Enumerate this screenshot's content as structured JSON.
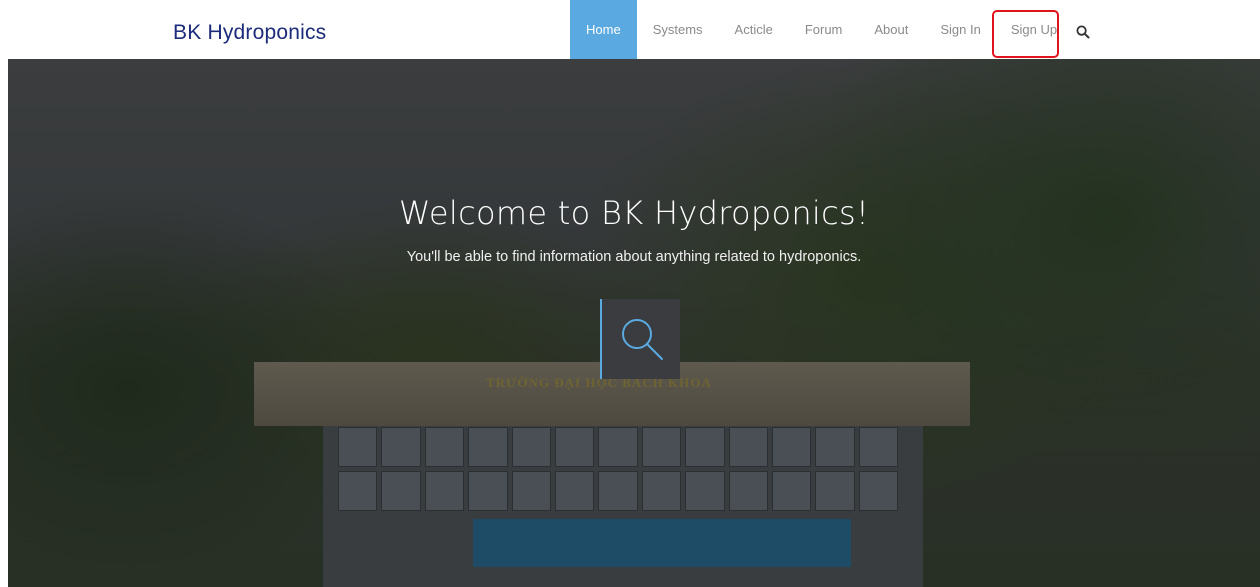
{
  "brand": {
    "name": "BK Hydroponics"
  },
  "nav": {
    "items": [
      {
        "label": "Home",
        "active": true
      },
      {
        "label": "Systems",
        "active": false
      },
      {
        "label": "Acticle",
        "active": false
      },
      {
        "label": "Forum",
        "active": false
      },
      {
        "label": "About",
        "active": false
      },
      {
        "label": "Sign In",
        "active": false
      },
      {
        "label": "Sign Up",
        "active": false,
        "highlighted": true
      }
    ],
    "search_icon": "search-icon"
  },
  "hero": {
    "title": "Welcome to BK Hydroponics!",
    "subtitle": "You'll be able to find information about anything related to hydroponics.",
    "search_icon": "search-icon",
    "building_sign": "TRƯỜNG ĐẠI HỌC BÁCH KHOA"
  },
  "colors": {
    "brand": "#1c2b7a",
    "accent": "#5aa9e0",
    "highlight": "#e0141c",
    "nav_text": "#8a8a8a"
  }
}
